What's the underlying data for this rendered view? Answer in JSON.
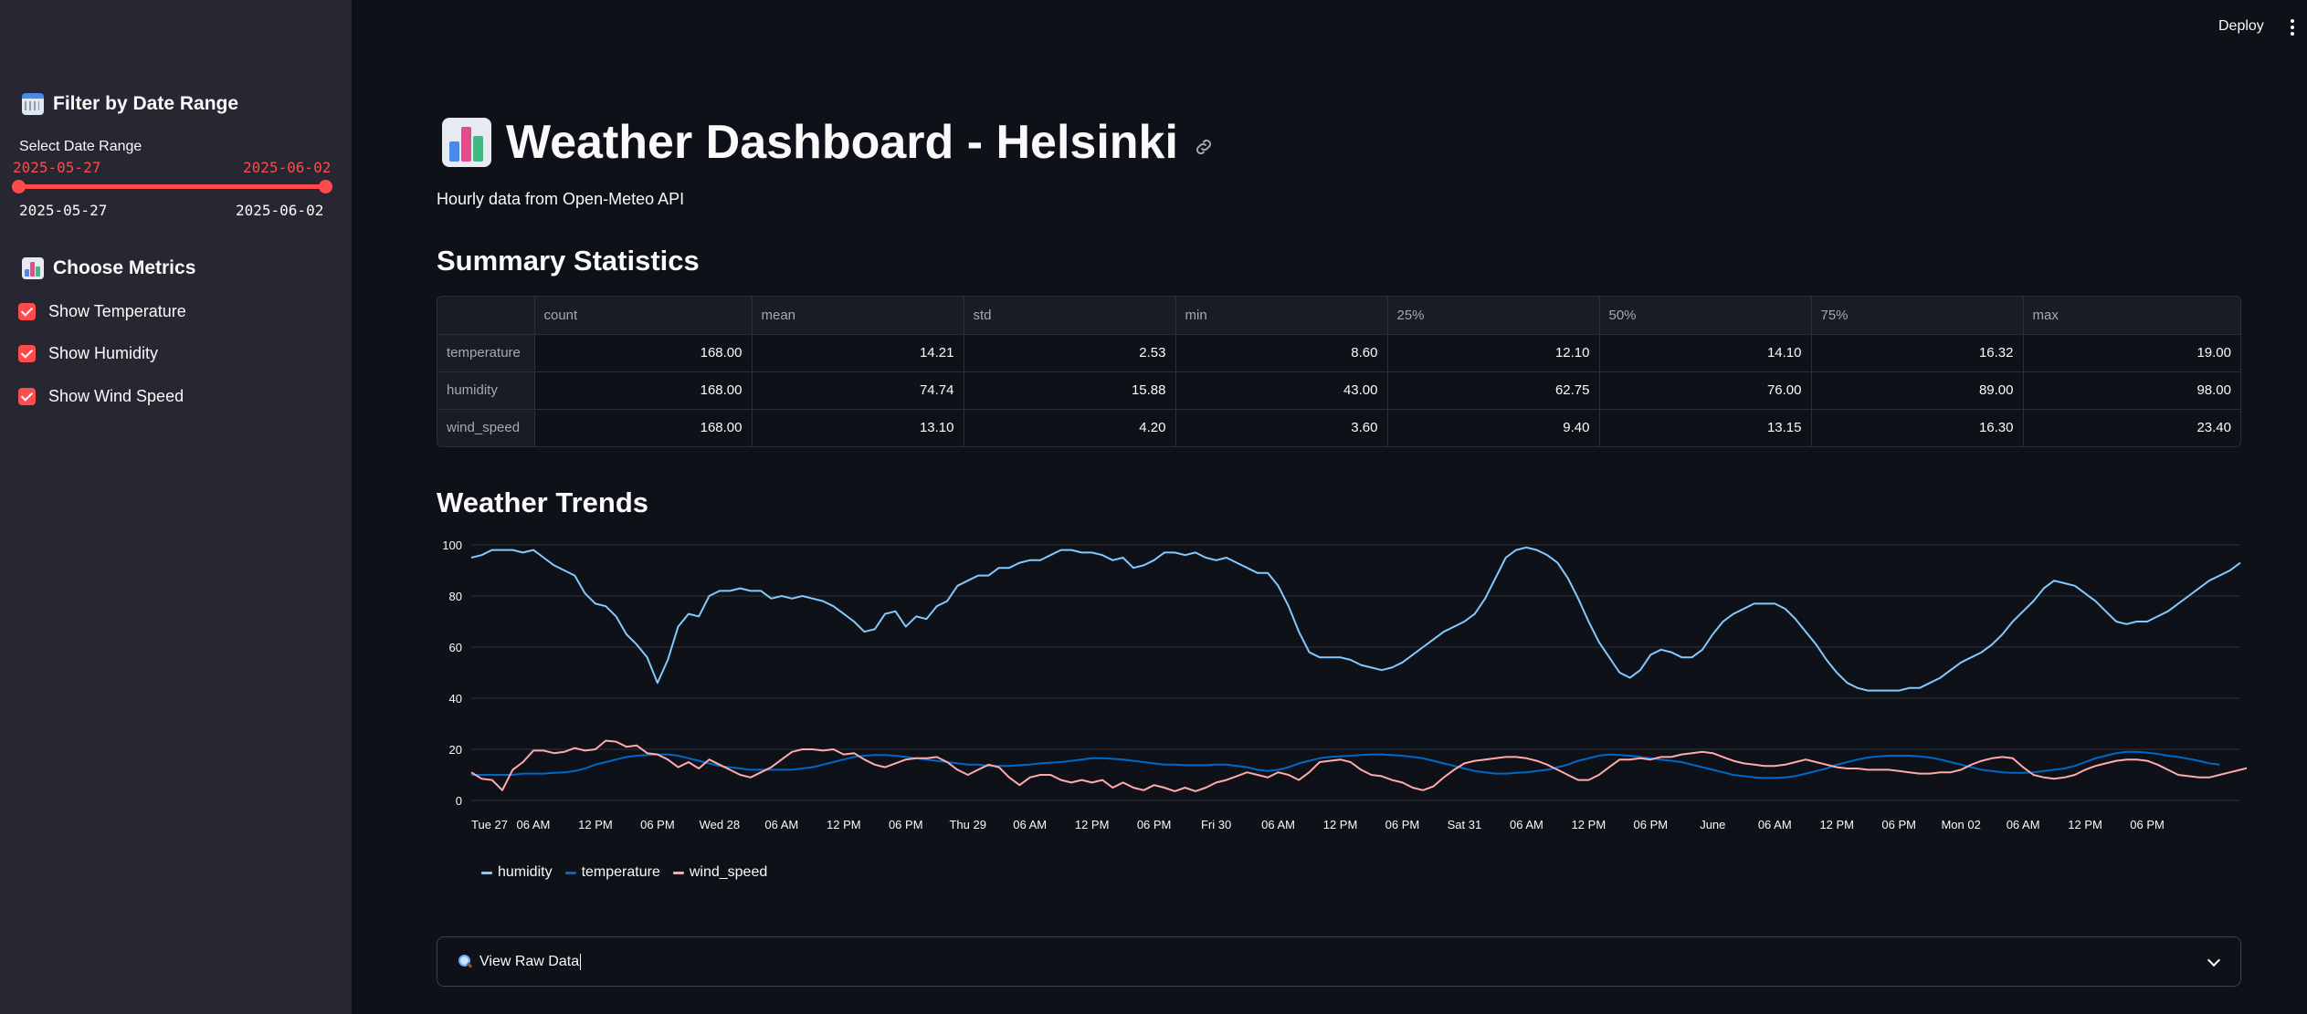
{
  "header": {
    "deploy_label": "Deploy",
    "menu_icon": "vertical-dots-icon"
  },
  "sidebar": {
    "filter_heading": "Filter by Date Range",
    "filter_icon": "calendar-icon",
    "slider_label": "Select Date Range",
    "slider_value_start": "2025-05-27",
    "slider_value_end": "2025-06-02",
    "slider_min": "2025-05-27",
    "slider_max": "2025-06-02",
    "slider_fill_fraction": 1.0,
    "metrics_heading": "Choose Metrics",
    "metrics_icon": "bar-chart-icon",
    "checkboxes": [
      {
        "label": "Show Temperature",
        "checked": true
      },
      {
        "label": "Show Humidity",
        "checked": true
      },
      {
        "label": "Show Wind Speed",
        "checked": true
      }
    ]
  },
  "main": {
    "title": "Weather Dashboard - Helsinki",
    "title_icon": "bar-chart-icon",
    "caption": "Hourly data from Open-Meteo API",
    "summary_heading": "Summary Statistics",
    "trends_heading": "Weather Trends",
    "expander_label": "View Raw Data",
    "expander_icon": "magnifier-icon"
  },
  "summary_table": {
    "columns": [
      "",
      "count",
      "mean",
      "std",
      "min",
      "25%",
      "50%",
      "75%",
      "max"
    ],
    "rows": [
      {
        "name": "temperature",
        "values": [
          "168.00",
          "14.21",
          "2.53",
          "8.60",
          "12.10",
          "14.10",
          "16.32",
          "19.00"
        ]
      },
      {
        "name": "humidity",
        "values": [
          "168.00",
          "74.74",
          "15.88",
          "43.00",
          "62.75",
          "76.00",
          "89.00",
          "98.00"
        ]
      },
      {
        "name": "wind_speed",
        "values": [
          "168.00",
          "13.10",
          "4.20",
          "3.60",
          "9.40",
          "13.15",
          "16.30",
          "23.40"
        ]
      }
    ]
  },
  "colors": {
    "accent": "#ff4b4b",
    "humidity": "#83c9ff",
    "temperature": "#0068c9",
    "wind_speed": "#ffabab"
  },
  "chart_data": {
    "type": "line",
    "title": "",
    "xlabel": "",
    "ylabel": "",
    "ylim": [
      0,
      100
    ],
    "yticks": [
      0,
      20,
      40,
      60,
      80,
      100
    ],
    "x_start": "2025-05-27T00:00",
    "x_step_hours": 1,
    "xtick_labels": [
      "Tue 27",
      "06 AM",
      "12 PM",
      "06 PM",
      "Wed 28",
      "06 AM",
      "12 PM",
      "06 PM",
      "Thu 29",
      "06 AM",
      "12 PM",
      "06 PM",
      "Fri 30",
      "06 AM",
      "12 PM",
      "06 PM",
      "Sat 31",
      "06 AM",
      "12 PM",
      "06 PM",
      "June",
      "06 AM",
      "12 PM",
      "06 PM",
      "Mon 02",
      "06 AM",
      "12 PM",
      "06 PM"
    ],
    "grid": true,
    "legend_position": "bottom-left",
    "series": [
      {
        "name": "humidity",
        "values": [
          95,
          96,
          98,
          98,
          98,
          97,
          98,
          95,
          92,
          90,
          88,
          81,
          77,
          76,
          72,
          65,
          61,
          56,
          46,
          55,
          68,
          73,
          72,
          80,
          82,
          82,
          83,
          82,
          82,
          79,
          80,
          79,
          80,
          79,
          78,
          76,
          73,
          70,
          66,
          67,
          73,
          74,
          68,
          72,
          71,
          76,
          78,
          84,
          86,
          88,
          88,
          91,
          91,
          93,
          94,
          94,
          96,
          98,
          98,
          97,
          97,
          96,
          94,
          95,
          91,
          92,
          94,
          97,
          97,
          96,
          97,
          95,
          94,
          95,
          93,
          91,
          89,
          89,
          84,
          76,
          66,
          58,
          56,
          56,
          56,
          55,
          53,
          52,
          51,
          52,
          54,
          57,
          60,
          63,
          66,
          68,
          70,
          73,
          79,
          87,
          95,
          98,
          99,
          98,
          96,
          93,
          87,
          79,
          70,
          62,
          56,
          50,
          48,
          51,
          57,
          59,
          58,
          56,
          56,
          59,
          65,
          70,
          73,
          75,
          77,
          77,
          77,
          75,
          71,
          66,
          61,
          55,
          50,
          46,
          44,
          43,
          43,
          43,
          43,
          44,
          44,
          46,
          48,
          51,
          54,
          56,
          58,
          61,
          65,
          70,
          74,
          78,
          83,
          86,
          85,
          84,
          81,
          78,
          74,
          70,
          69,
          70,
          70,
          72,
          74,
          77,
          80,
          83,
          86,
          88,
          90,
          93
        ]
      },
      {
        "name": "temperature",
        "values": [
          10,
          10,
          10,
          10,
          10,
          10.5,
          10.5,
          10.5,
          10.8,
          11,
          11.5,
          12.5,
          14,
          15,
          16,
          17,
          17.5,
          17.8,
          18,
          18,
          17.5,
          16.5,
          15.5,
          14.5,
          13.5,
          13,
          12.5,
          12,
          12,
          12,
          12,
          12,
          12.5,
          13,
          14,
          15,
          16,
          17,
          17.5,
          17.8,
          17.8,
          17.5,
          17,
          16.5,
          16,
          15.5,
          15,
          14.5,
          14,
          14,
          13.5,
          13.5,
          13.5,
          13.8,
          14,
          14.5,
          14.8,
          15,
          15.5,
          16,
          16.5,
          16.5,
          16.3,
          16,
          15.5,
          15,
          14.5,
          14,
          14,
          13.8,
          13.8,
          13.8,
          14,
          14,
          13.5,
          13,
          12,
          11.5,
          12,
          13,
          14.5,
          15.5,
          16.5,
          17,
          17.3,
          17.5,
          17.8,
          18,
          18,
          17.8,
          17.5,
          17,
          16.5,
          15.5,
          14.5,
          13.5,
          12.5,
          11.5,
          11,
          10.5,
          10.5,
          10.8,
          11,
          11.5,
          12,
          13,
          14,
          15.5,
          16.5,
          17.5,
          18,
          17.8,
          17.5,
          17,
          16.5,
          16,
          15.5,
          15,
          14,
          13,
          12,
          11,
          10,
          9.5,
          9,
          8.8,
          8.8,
          9,
          9.5,
          10.5,
          11.5,
          12.5,
          14,
          15,
          16,
          16.8,
          17.2,
          17.5,
          17.5,
          17.5,
          17.2,
          16.8,
          16,
          15,
          14,
          13,
          12,
          11.5,
          11,
          10.8,
          10.8,
          11,
          11.5,
          12,
          12.5,
          13.5,
          15,
          16.5,
          17.5,
          18.5,
          19,
          19,
          18.7,
          18.2,
          17.5,
          17,
          16.3,
          15.5,
          14.5,
          14
        ]
      },
      {
        "name": "wind_speed",
        "values": [
          11,
          8.5,
          8,
          4,
          12,
          15,
          19.5,
          19.5,
          18.5,
          19,
          20.5,
          19.5,
          20,
          23.4,
          23,
          21,
          21.5,
          18.5,
          18,
          16,
          13,
          15,
          12.5,
          16,
          14,
          12,
          10,
          9,
          11,
          13,
          16,
          19,
          20,
          20,
          19.5,
          20,
          18,
          18.5,
          16,
          14,
          13,
          14.5,
          16,
          16.5,
          16.5,
          17,
          15,
          12,
          10,
          12,
          14,
          13,
          9,
          6,
          9,
          10,
          10,
          8,
          7,
          8,
          7,
          8,
          5,
          7,
          5,
          4,
          6,
          5,
          3.6,
          5,
          3.6,
          5,
          7,
          8,
          9.5,
          11,
          10,
          9,
          11,
          10,
          8,
          11,
          15,
          15.5,
          16,
          15,
          12,
          10,
          9.5,
          8,
          7,
          5,
          4,
          5.5,
          9,
          12,
          14.5,
          15.5,
          16,
          16.5,
          17,
          17,
          16.5,
          15.5,
          14,
          12,
          10,
          8,
          8,
          10,
          13,
          16,
          16,
          16.5,
          16,
          17,
          17,
          18,
          18.5,
          19,
          18.5,
          17,
          15.5,
          14.5,
          14,
          13.5,
          13.5,
          14,
          15,
          16,
          15,
          14,
          13,
          12.5,
          12.5,
          12,
          12,
          12,
          11.5,
          11,
          10.5,
          10.5,
          11,
          11,
          12,
          14,
          15.5,
          16.5,
          17,
          16.5,
          13,
          10,
          9,
          8.5,
          9,
          10,
          12,
          13.5,
          14.5,
          15.5,
          16,
          16,
          15.5,
          14,
          12,
          10,
          9.5,
          9,
          9,
          10,
          11,
          12,
          13,
          13.5,
          13.5,
          13,
          12,
          11.5
        ]
      }
    ]
  }
}
